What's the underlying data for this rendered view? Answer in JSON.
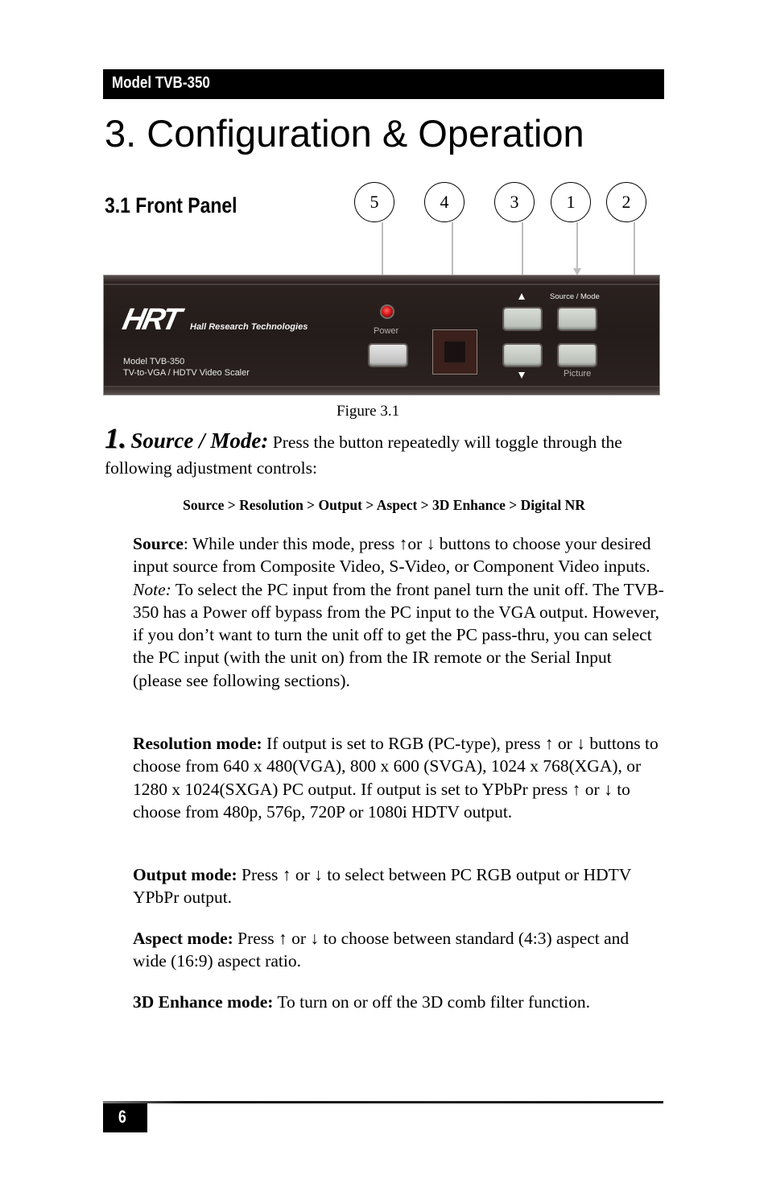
{
  "header": {
    "model": "Model TVB-350"
  },
  "chapter": {
    "title": "3. Configuration & Operation"
  },
  "section": {
    "title": "3.1 Front Panel"
  },
  "figure": {
    "callouts": [
      "5",
      "4",
      "3",
      "1",
      "2"
    ],
    "panel": {
      "logo": "HRT",
      "company": "Hall Research Technologies",
      "model_line": "Model TVB-350",
      "description": "TV-to-VGA / HDTV Video Scaler",
      "power_label": "Power",
      "source_mode_label": "Source / Mode",
      "picture_label": "Picture",
      "led_color": "#d81818"
    },
    "caption": "Figure 3.1"
  },
  "item1": {
    "number": "1.",
    "name": "Source / Mode:",
    "text": " Press the button repeatedly will toggle through the following adjustment controls:",
    "sequence": "Source > Resolution > Output > Aspect > 3D Enhance > Digital NR"
  },
  "modes": {
    "source": {
      "label": "Source",
      "text_a": ": While under this mode, press ↑or ↓ buttons to choose your desired input source from Composite Video, S-Video, or Component Video inputs. ",
      "note_label": "Note:",
      "text_b": " To select the PC input from the front panel turn the unit off. The TVB-350 has a Power off bypass from the PC input to the VGA output. However, if you don’t want to turn the unit off to get the PC pass-thru, you can select the PC input (with the unit on) from the IR remote or the Serial Input (please see following sections)."
    },
    "resolution": {
      "label": "Resolution mode:",
      "text": " If output is set to RGB (PC-type), press ↑ or ↓ buttons to choose from 640 x 480(VGA), 800 x 600 (SVGA), 1024 x 768(XGA), or 1280 x 1024(SXGA) PC output. If output is set to YPbPr press ↑ or ↓ to choose from 480p, 576p, 720P or 1080i HDTV output."
    },
    "output": {
      "label": "Output mode:",
      "text": " Press ↑ or ↓ to select between PC RGB output or HDTV YPbPr output."
    },
    "aspect": {
      "label": "Aspect mode:",
      "text": " Press ↑ or ↓ to choose between standard (4:3) aspect and wide (16:9) aspect ratio."
    },
    "enhance3d": {
      "label": "3D Enhance mode:",
      "text": " To turn on or off the 3D comb filter function."
    }
  },
  "footer": {
    "page_number": "6"
  }
}
